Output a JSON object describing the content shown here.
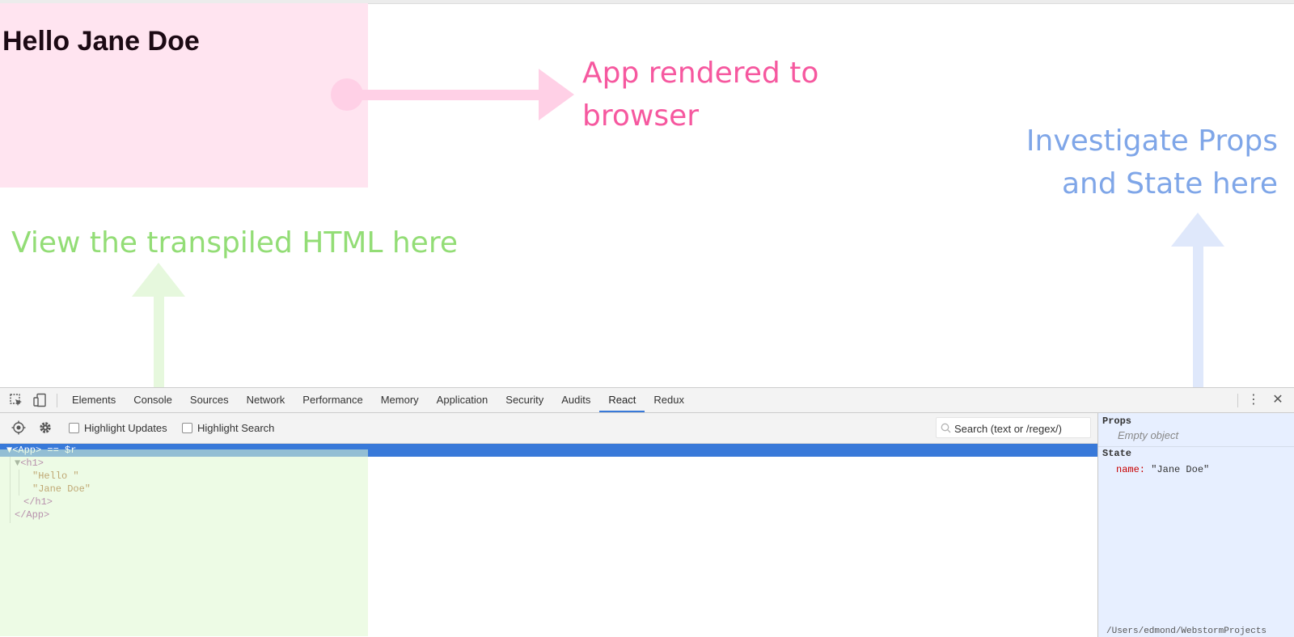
{
  "app": {
    "heading": "Hello Jane Doe"
  },
  "annotations": {
    "rendered": [
      "App rendered to",
      "browser"
    ],
    "props_state": [
      "Investigate Props",
      "and State here"
    ],
    "transpiled": "View the transpiled HTML here"
  },
  "devtools": {
    "tabs": [
      {
        "label": "Elements",
        "active": false
      },
      {
        "label": "Console",
        "active": false
      },
      {
        "label": "Sources",
        "active": false
      },
      {
        "label": "Network",
        "active": false
      },
      {
        "label": "Performance",
        "active": false
      },
      {
        "label": "Memory",
        "active": false
      },
      {
        "label": "Application",
        "active": false
      },
      {
        "label": "Security",
        "active": false
      },
      {
        "label": "Audits",
        "active": false
      },
      {
        "label": "React",
        "active": true
      },
      {
        "label": "Redux",
        "active": false
      }
    ],
    "react_toolbar": {
      "highlight_updates": "Highlight Updates",
      "highlight_search": "Highlight Search",
      "search_placeholder": "Search (text or /regex/)"
    },
    "tree": {
      "root_open": "<App>",
      "root_suffix": " == $r",
      "child_open": "<h1>",
      "text_1": "\"Hello \"",
      "text_2": "\"Jane Doe\"",
      "child_close": "</h1>",
      "root_close": "</App>"
    },
    "sidebar": {
      "props_title": "Props",
      "props_empty": "Empty object",
      "state_title": "State",
      "state_key": "name:",
      "state_value": "\"Jane Doe\"",
      "path": "/Users/edmond/WebstormProjects"
    }
  },
  "colors": {
    "pink_accent": "#f6589f",
    "blue_accent": "#7fa6e8",
    "green_accent": "#93dd76",
    "selection": "#3879d9"
  }
}
